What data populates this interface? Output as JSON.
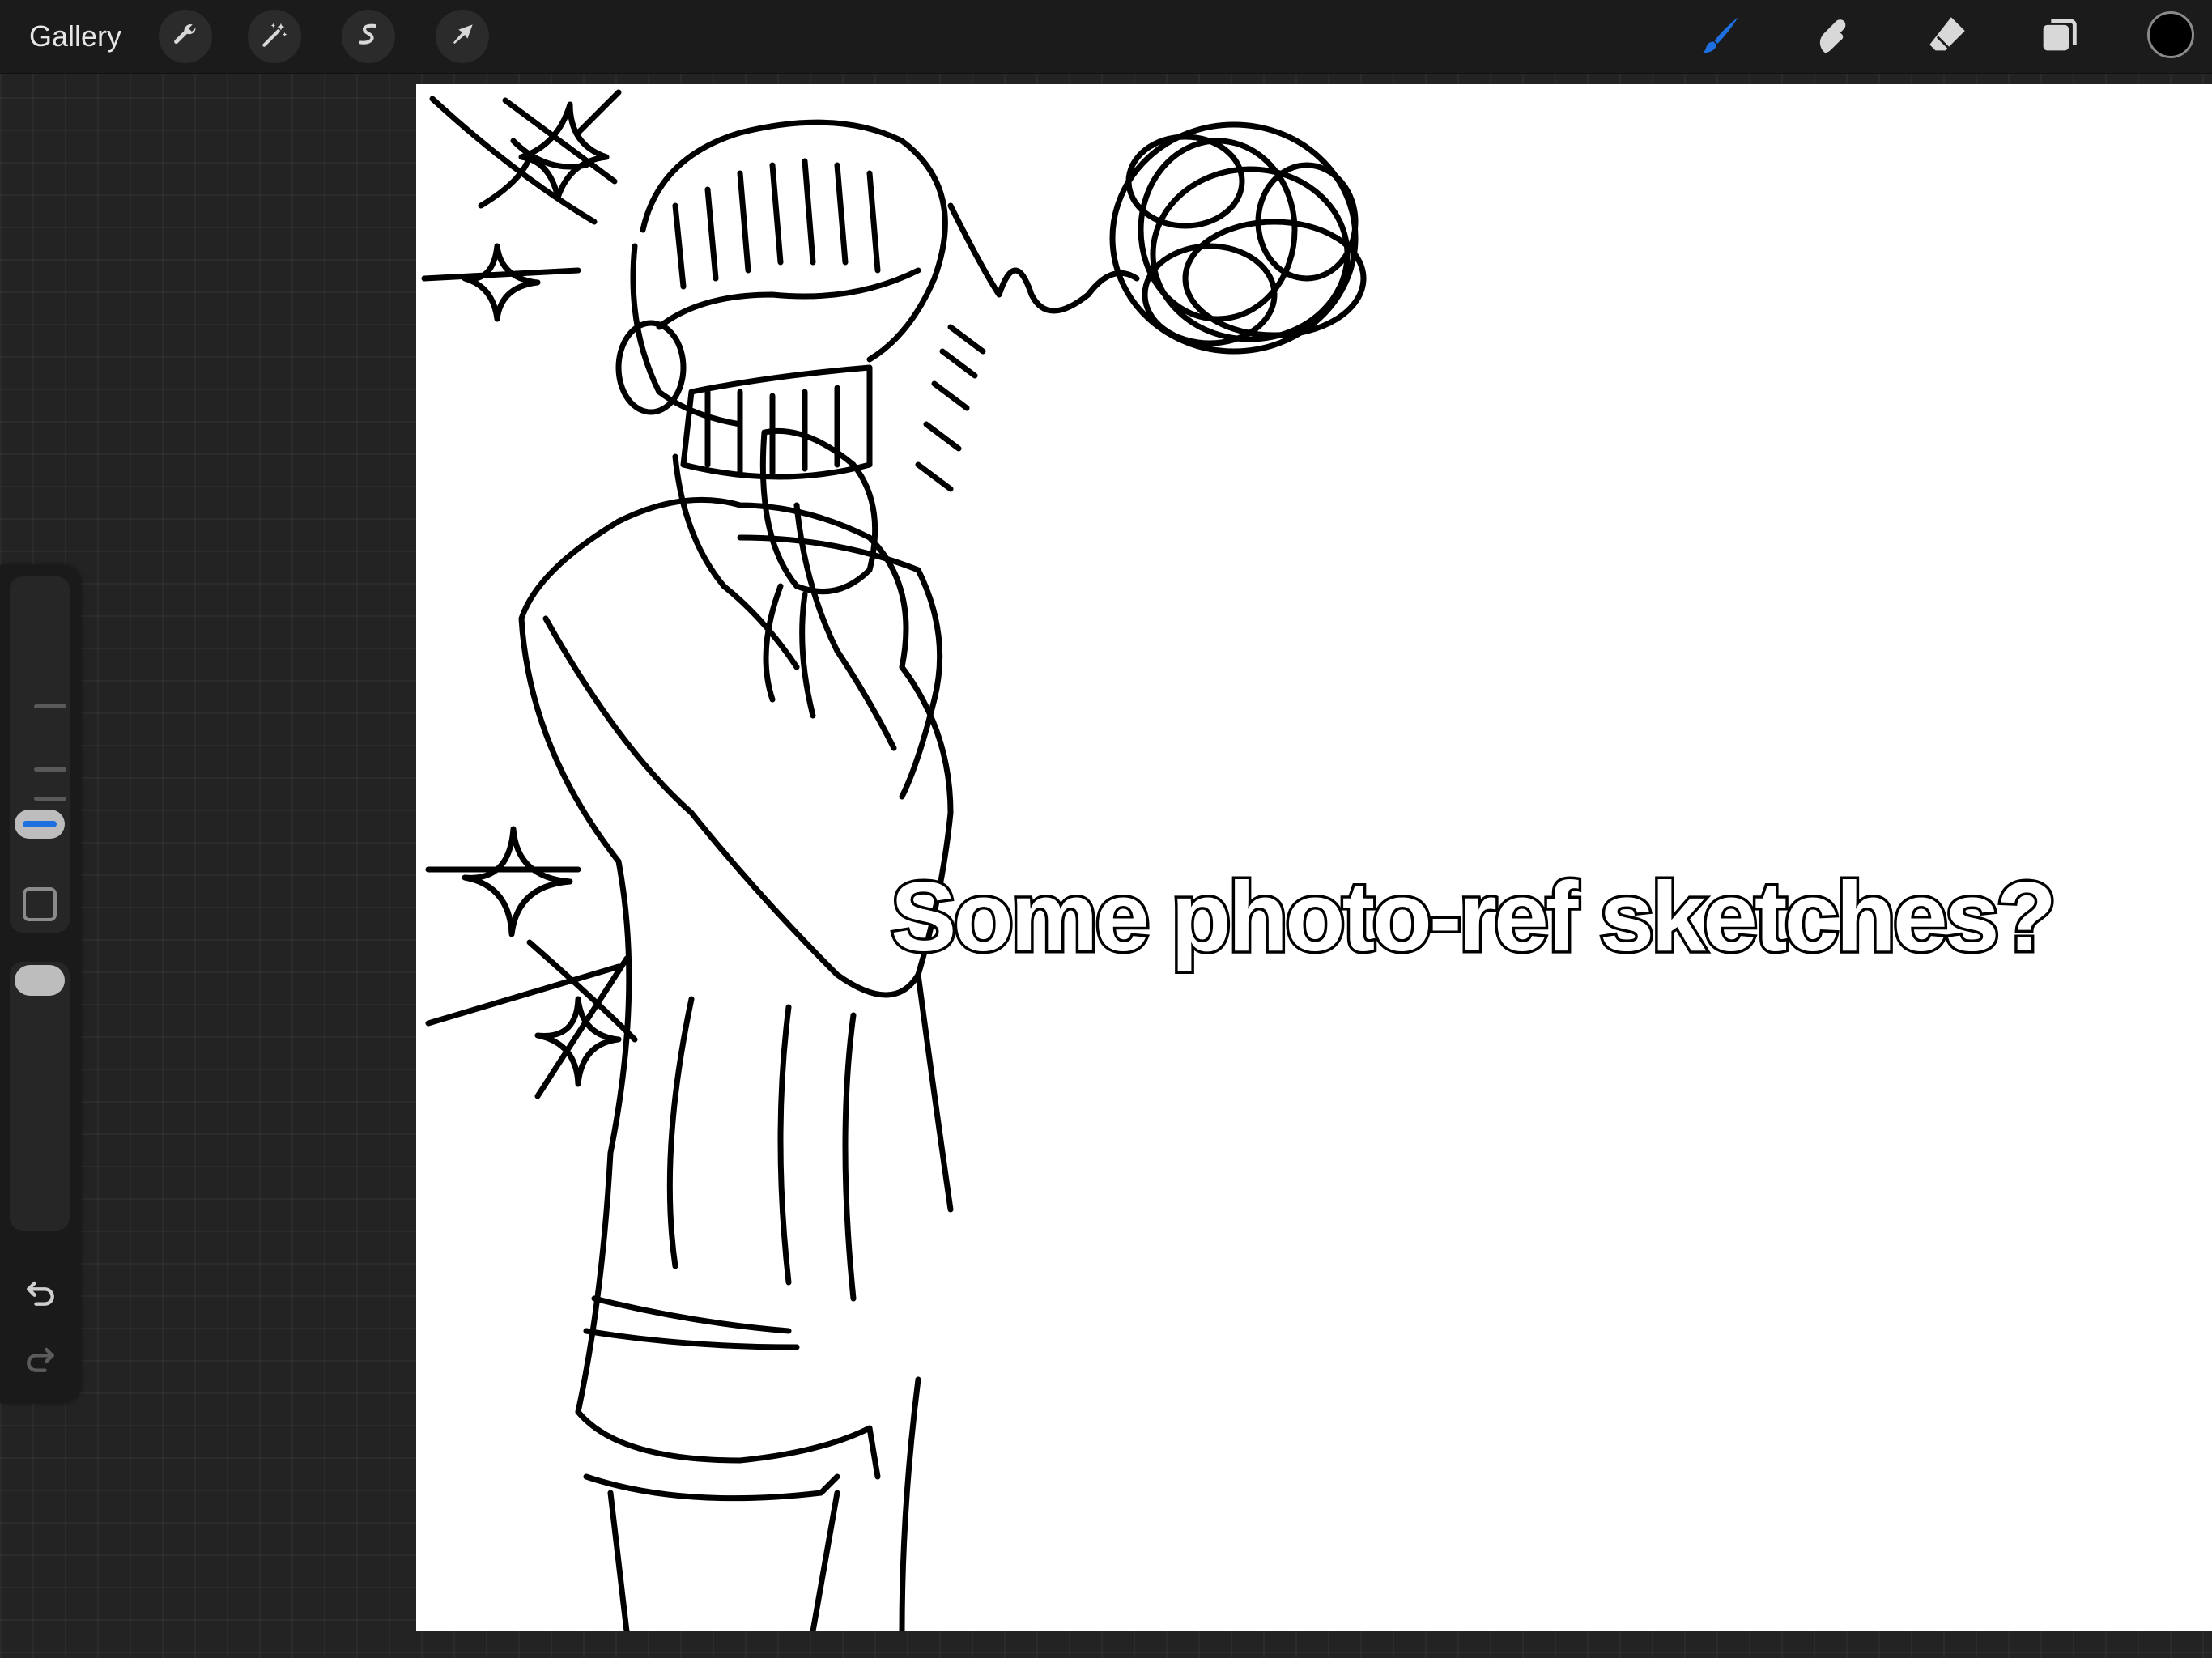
{
  "topbar": {
    "gallery_label": "Gallery",
    "left_tools": [
      {
        "name": "actions",
        "icon": "wrench-icon"
      },
      {
        "name": "adjustments",
        "icon": "magic-wand-icon"
      },
      {
        "name": "selection",
        "icon": "selection-s-icon"
      },
      {
        "name": "transform",
        "icon": "arrow-cursor-icon"
      }
    ],
    "right_tools": [
      {
        "name": "brush",
        "icon": "brush-icon",
        "active": true
      },
      {
        "name": "smudge",
        "icon": "smudge-icon",
        "active": false
      },
      {
        "name": "eraser",
        "icon": "eraser-icon",
        "active": false
      },
      {
        "name": "layers",
        "icon": "layers-icon",
        "active": false
      }
    ],
    "current_color": "#000000"
  },
  "sidebar": {
    "brush_size_level": 0.4,
    "opacity_level": 1.0,
    "undo_icon": "undo-icon",
    "redo_icon": "redo-icon",
    "accent_color": "#1e6fe0"
  },
  "canvas": {
    "background": "#ffffff",
    "caption": "Some photo-ref sketches?"
  }
}
